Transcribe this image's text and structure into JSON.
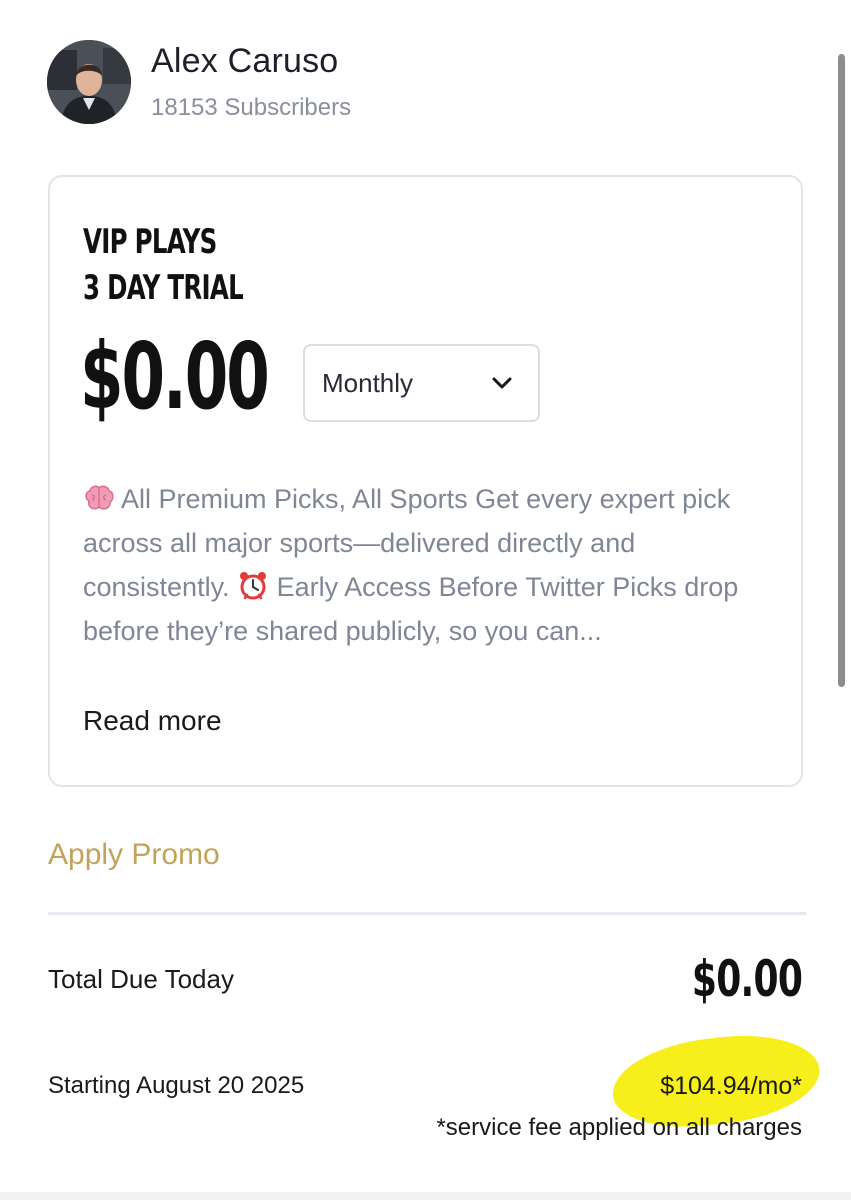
{
  "creator": {
    "name": "Alex Caruso",
    "subscribers": "18153 Subscribers"
  },
  "plan": {
    "title_line1": "VIP PLAYS",
    "title_line2": "3 DAY TRIAL",
    "price": "$0.00",
    "billing_period": "Monthly",
    "description": {
      "brain_icon": "brain-emoji",
      "part1": " All Premium Picks, All Sports Get every expert pick across all major sports—delivered directly and consistently. ",
      "clock_icon": "alarm-clock-emoji",
      "part2": " Early Access Before Twitter Picks drop before they’re shared publicly, so you can..."
    },
    "read_more": "Read more"
  },
  "promo": {
    "label": "Apply Promo"
  },
  "summary": {
    "total_label": "Total Due Today",
    "total_amount": "$0.00",
    "starting_label": "Starting August 20 2025",
    "recurring_price": "$104.94/mo*",
    "fee_note": "*service fee applied on all charges"
  },
  "colors": {
    "promo_gold": "#c1a35a",
    "highlight_yellow": "#f6ef1c",
    "muted_text": "#7f8695"
  }
}
